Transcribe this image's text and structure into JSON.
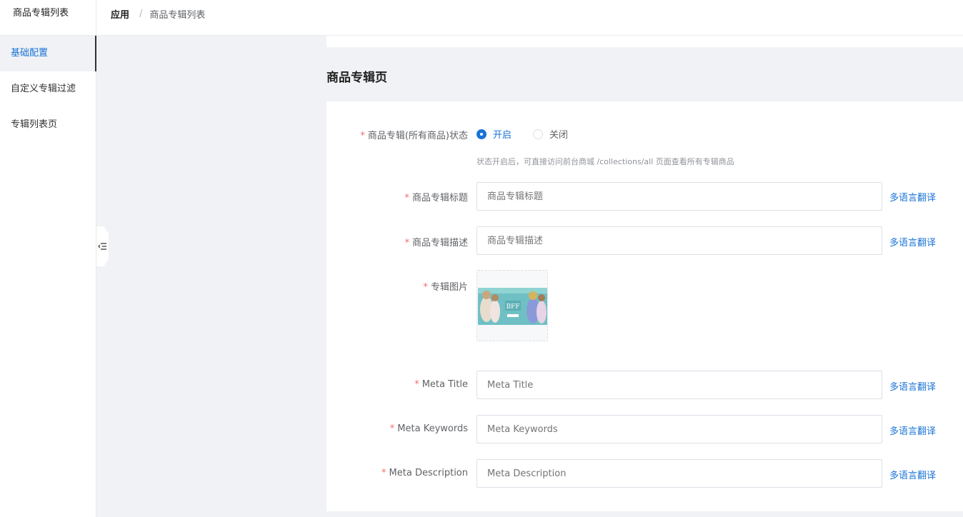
{
  "sidebar": {
    "title": "商品专辑列表",
    "items": [
      {
        "label": "基础配置",
        "active": true
      },
      {
        "label": "自定义专辑过滤",
        "active": false
      },
      {
        "label": "专辑列表页",
        "active": false
      }
    ]
  },
  "breadcrumb": {
    "items": [
      "应用",
      "商品专辑列表"
    ],
    "separator": "/"
  },
  "section": {
    "title": "商品专辑页"
  },
  "form": {
    "status": {
      "label": "商品专辑(所有商品)状态",
      "options": [
        "开启",
        "关闭"
      ],
      "selected": "开启",
      "hint": "状态开启后，可直接访问前台商城 /collections/all 页面查看所有专辑商品"
    },
    "title": {
      "label": "商品专辑标题",
      "placeholder": "商品专辑标题",
      "translate": "多语言翻译"
    },
    "description": {
      "label": "商品专辑描述",
      "placeholder": "商品专辑描述",
      "translate": "多语言翻译"
    },
    "image": {
      "label": "专辑图片",
      "banner_text": "BFF"
    },
    "meta_title": {
      "label": "Meta Title",
      "placeholder": "Meta Title",
      "translate": "多语言翻译"
    },
    "meta_keywords": {
      "label": "Meta Keywords",
      "placeholder": "Meta Keywords",
      "translate": "多语言翻译"
    },
    "meta_description": {
      "label": "Meta Description",
      "placeholder": "Meta Description",
      "translate": "多语言翻译"
    }
  },
  "colors": {
    "primary": "#1a73d6",
    "required": "#f56c6c",
    "background": "#f0f2f5"
  }
}
